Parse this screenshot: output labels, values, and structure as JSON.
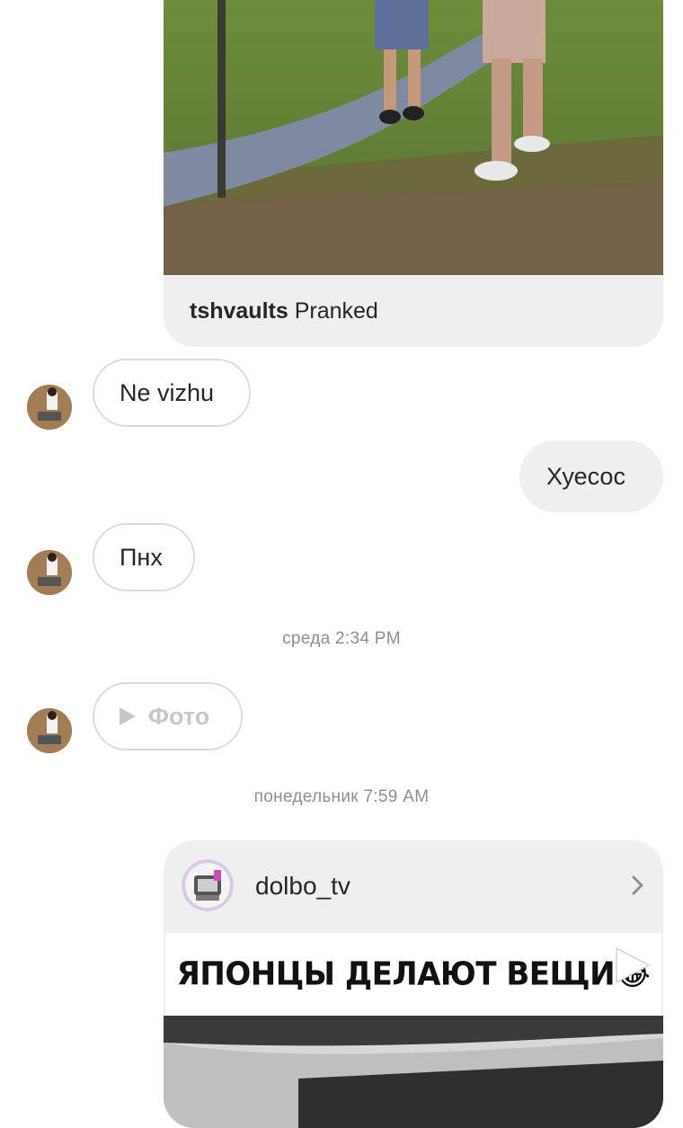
{
  "messages": {
    "shared_post_1": {
      "author": "tshvaults",
      "caption": "Pranked"
    },
    "incoming_1": "Ne vizhu",
    "outgoing_1": "Хуесос",
    "incoming_2": "Пнх",
    "timestamp_1": "среда 2:34 PM",
    "incoming_photo_label": "Фото",
    "timestamp_2": "понедельник 7:59 AM",
    "shared_post_2": {
      "author": "dolbo_tv",
      "banner_text": "ЯПОНЦЫ ДЕЛАЮТ ВЕЩИ😂"
    }
  },
  "icons": {
    "avatar": "profile-photo",
    "play": "play-icon",
    "chevron": "chevron-right-icon",
    "video_play": "play-triangle-icon"
  },
  "colors": {
    "bubble_gray": "#efefef",
    "border": "#dbdbdb",
    "timestamp": "#8e8e8e",
    "disabled_text": "#c7c7c7"
  }
}
